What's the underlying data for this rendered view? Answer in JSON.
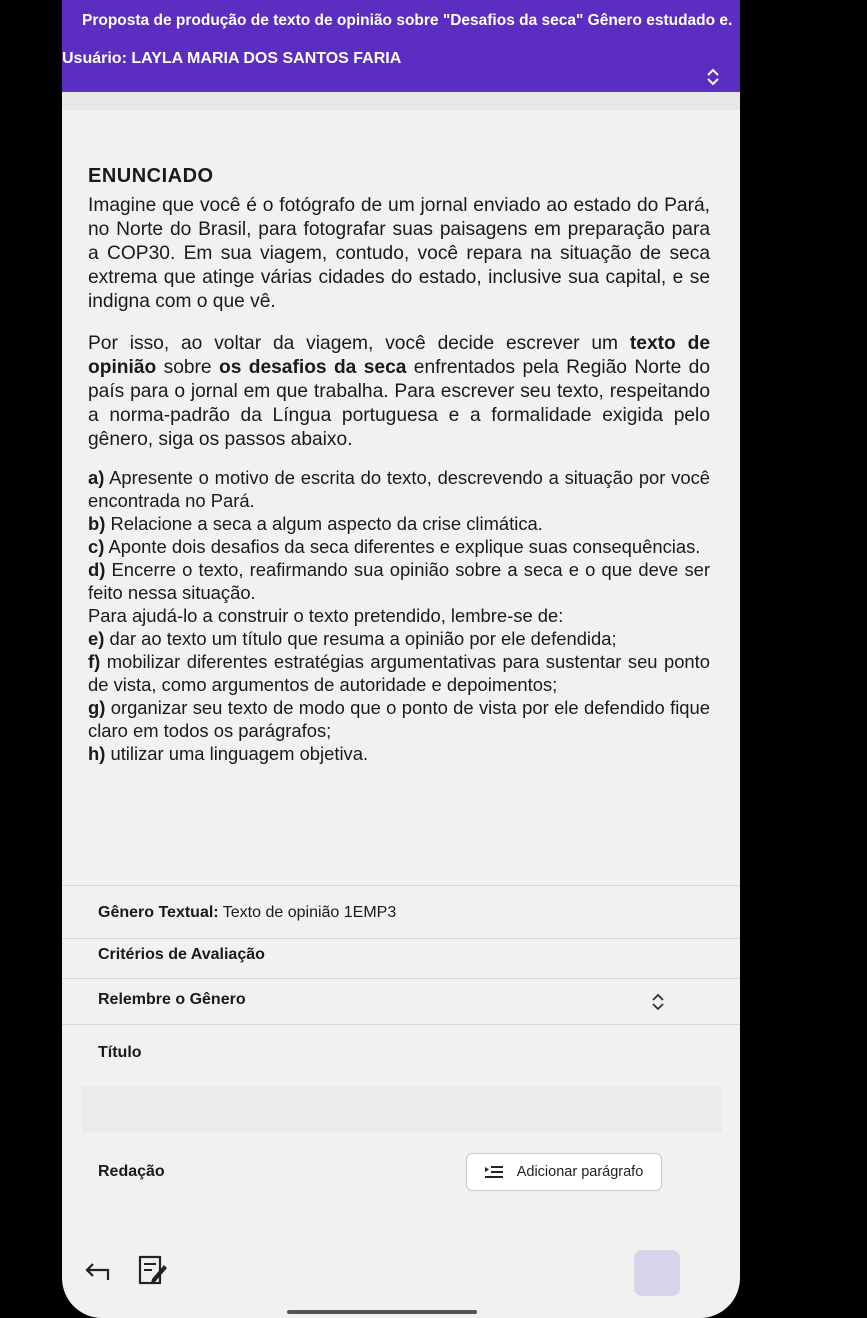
{
  "header": {
    "title": "Proposta de produção de texto de opinião sobre \"Desafios da seca\" Gênero estudado e...",
    "user": "Usuário: LAYLA MARIA DOS SANTOS FARIA"
  },
  "enunciado": {
    "heading": "ENUNCIADO",
    "p1": "Imagine que você é o fotógrafo de um jornal enviado ao estado do Pará, no Norte do Brasil, para fotografar suas paisagens em preparação para a COP30. Em sua viagem, contudo, você repara na situação de seca extrema que atinge várias cidades do estado, inclusive sua capital, e se indigna com o que vê.",
    "p2_a": "Por isso, ao voltar da viagem, você decide escrever um ",
    "p2_b1": "texto de opinião",
    "p2_c": " sobre ",
    "p2_b2": "os desafios da seca",
    "p2_d": " enfrentados pela Região Norte do país para o jornal em que trabalha. Para escrever seu texto, respeitando a norma-padrão da Língua portuguesa e a formalidade exigida pelo gênero, siga os passos abaixo.",
    "items": [
      {
        "letter": "a)",
        "text": " Apresente o motivo de escrita do texto, descrevendo a situação por você encontrada no Pará."
      },
      {
        "letter": "b)",
        "text": " Relacione a seca a algum aspecto da crise climática."
      },
      {
        "letter": "c)",
        "text": " Aponte dois desafios da seca diferentes e explique suas consequências."
      },
      {
        "letter": "d)",
        "text": " Encerre o texto, reafirmando sua opinião sobre a seca e o que deve ser feito nessa situação."
      }
    ],
    "helper": "Para ajudá-lo a construir o texto pretendido, lembre-se de:",
    "tips": [
      {
        "letter": "e)",
        "text": " dar ao texto um título que resuma a opinião por ele defendida;"
      },
      {
        "letter": "f)",
        "text": " mobilizar diferentes estratégias argumentativas para sustentar seu ponto de vista, como argumentos de autoridade e depoimentos;"
      },
      {
        "letter": "g)",
        "text": " organizar seu texto de modo que o ponto de vista por ele defendido fique claro em todos os parágrafos;"
      },
      {
        "letter": "h)",
        "text": " utilizar uma linguagem objetiva."
      }
    ]
  },
  "genero": {
    "label": "Gênero Textual:",
    "value": " Texto de opinião 1EMP3"
  },
  "criterios": "Critérios de Avaliação",
  "relembre": "Relembre o Gênero",
  "titulo": "Título",
  "redacao": "Redação",
  "add_paragraph": "Adicionar parágrafo",
  "icons": [
    "chevron-updown-icon",
    "add-paragraph-icon",
    "back-arrow-icon",
    "edit-icon",
    "send-icon"
  ],
  "colors": {
    "header": "#5b2dc0",
    "background": "#f1f1ef"
  }
}
